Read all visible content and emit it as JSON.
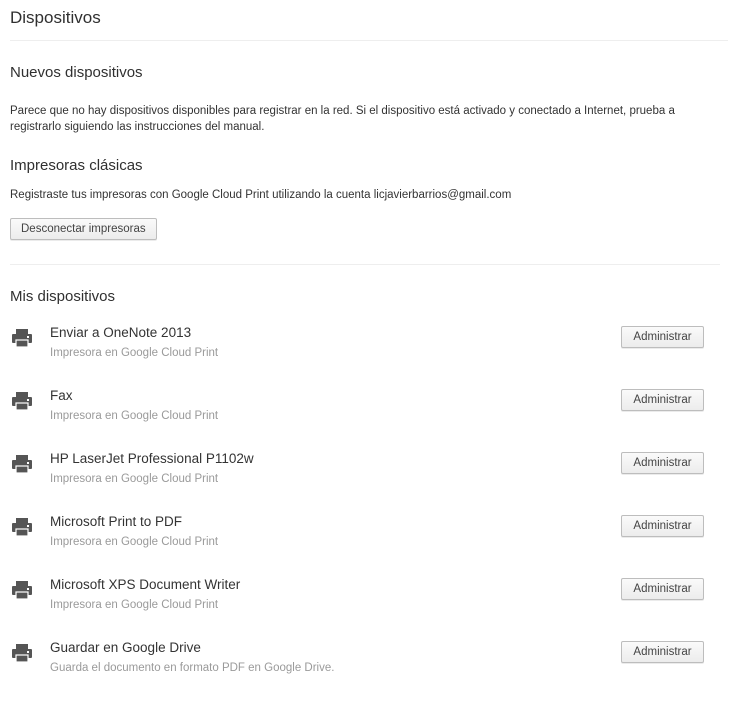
{
  "page": {
    "title": "Dispositivos"
  },
  "new_devices": {
    "heading": "Nuevos dispositivos",
    "message_line1": "Parece que no hay dispositivos disponibles para registrar en la red. Si el dispositivo está activado y conectado a Internet, prueba a",
    "message_line2": "registrarlo siguiendo las instrucciones del manual."
  },
  "classic_printers": {
    "heading": "Impresoras clásicas",
    "message": "Registraste tus impresoras con Google Cloud Print utilizando la cuenta licjavierbarrios@gmail.com",
    "disconnect_label": "Desconectar impresoras"
  },
  "my_devices": {
    "heading": "Mis dispositivos",
    "manage_label": "Administrar",
    "icon": "printer-icon",
    "items": [
      {
        "name": "Enviar a OneNote 2013",
        "description": "Impresora en Google Cloud Print"
      },
      {
        "name": "Fax",
        "description": "Impresora en Google Cloud Print"
      },
      {
        "name": "HP LaserJet Professional P1102w",
        "description": "Impresora en Google Cloud Print"
      },
      {
        "name": "Microsoft Print to PDF",
        "description": "Impresora en Google Cloud Print"
      },
      {
        "name": "Microsoft XPS Document Writer",
        "description": "Impresora en Google Cloud Print"
      },
      {
        "name": "Guardar en Google Drive",
        "description": "Guarda el documento en formato PDF en Google Drive."
      }
    ]
  },
  "colors": {
    "icon": "#555555",
    "secondary_text": "#9a9a9a",
    "divider": "#eeeeee"
  }
}
